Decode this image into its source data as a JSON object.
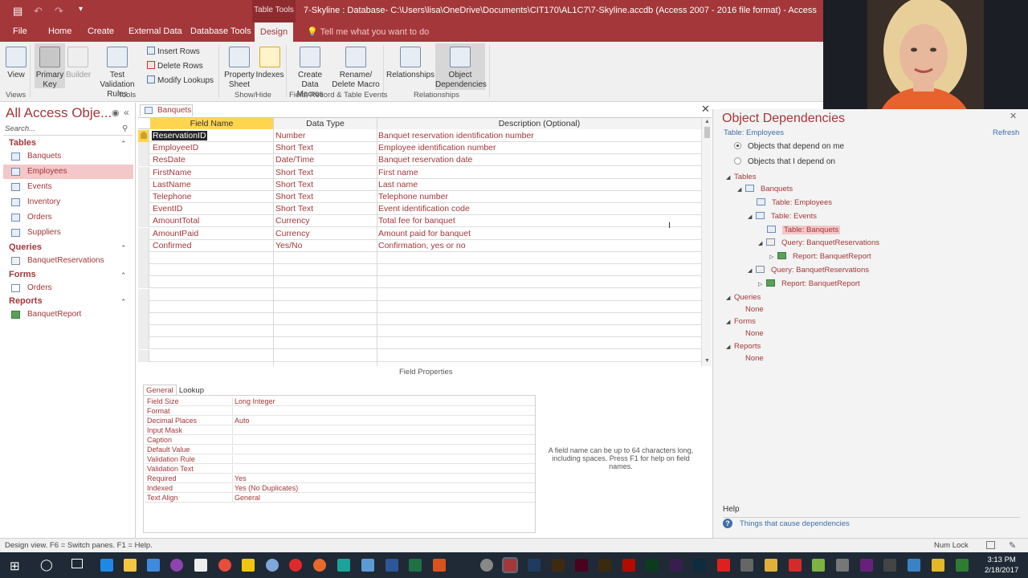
{
  "window": {
    "title": "7-Skyline : Database- C:\\Users\\lisa\\OneDrive\\Documents\\CIT170\\AL1C7\\7-Skyline.accdb (Access 2007 - 2016 file format) - Access",
    "context_tab": "Table Tools"
  },
  "ribbon_tabs": [
    "File",
    "Home",
    "Create",
    "External Data",
    "Database Tools",
    "Design"
  ],
  "tell_me": "Tell me what you want to do",
  "ribbon": {
    "view": "View",
    "primary_key": [
      "Primary",
      "Key"
    ],
    "builder": "Builder",
    "test_validation": [
      "Test Validation",
      "Rules"
    ],
    "insert_rows": "Insert Rows",
    "delete_rows": "Delete Rows",
    "modify_lookups": "Modify Lookups",
    "property_sheet": [
      "Property",
      "Sheet"
    ],
    "indexes": "Indexes",
    "create_data_macros": [
      "Create Data",
      "Macros"
    ],
    "rename_delete_macro": [
      "Rename/",
      "Delete Macro"
    ],
    "relationships": "Relationships",
    "object_dependencies": [
      "Object",
      "Dependencies"
    ],
    "groups": {
      "views": "Views",
      "tools": "Tools",
      "show_hide": "Show/Hide",
      "field_events": "Field, Record & Table Events",
      "relationships": "Relationships"
    }
  },
  "nav": {
    "title": "All Access Obje...",
    "search_placeholder": "Search...",
    "sections": {
      "tables": "Tables",
      "queries": "Queries",
      "forms": "Forms",
      "reports": "Reports"
    },
    "tables": [
      "Banquets",
      "Employees",
      "Events",
      "Inventory",
      "Orders",
      "Suppliers"
    ],
    "queries": [
      "BanquetReservations"
    ],
    "forms": [
      "Orders"
    ],
    "reports": [
      "BanquetReport"
    ]
  },
  "doc_tab": "Banquets",
  "grid": {
    "headers": [
      "Field Name",
      "Data Type",
      "Description (Optional)"
    ],
    "rows": [
      {
        "name": "ReservationID",
        "type": "Number",
        "desc": "Banquet reservation identification number"
      },
      {
        "name": "EmployeeID",
        "type": "Short Text",
        "desc": "Employee identification number"
      },
      {
        "name": "ResDate",
        "type": "Date/Time",
        "desc": "Banquet reservation date"
      },
      {
        "name": "FirstName",
        "type": "Short Text",
        "desc": "First name"
      },
      {
        "name": "LastName",
        "type": "Short Text",
        "desc": "Last name"
      },
      {
        "name": "Telephone",
        "type": "Short Text",
        "desc": "Telephone number"
      },
      {
        "name": "EventID",
        "type": "Short Text",
        "desc": "Event identification code"
      },
      {
        "name": "AmountTotal",
        "type": "Currency",
        "desc": "Total fee for banquet"
      },
      {
        "name": "AmountPaid",
        "type": "Currency",
        "desc": "Amount paid for banquet"
      },
      {
        "name": "Confirmed",
        "type": "Yes/No",
        "desc": "Confirmation, yes or no"
      }
    ]
  },
  "field_properties": {
    "label": "Field Properties",
    "tabs": [
      "General",
      "Lookup"
    ],
    "rows": [
      {
        "label": "Field Size",
        "value": "Long Integer"
      },
      {
        "label": "Format",
        "value": ""
      },
      {
        "label": "Decimal Places",
        "value": "Auto"
      },
      {
        "label": "Input Mask",
        "value": ""
      },
      {
        "label": "Caption",
        "value": ""
      },
      {
        "label": "Default Value",
        "value": ""
      },
      {
        "label": "Validation Rule",
        "value": ""
      },
      {
        "label": "Validation Text",
        "value": ""
      },
      {
        "label": "Required",
        "value": "Yes"
      },
      {
        "label": "Indexed",
        "value": "Yes (No Duplicates)"
      },
      {
        "label": "Text Align",
        "value": "General"
      }
    ],
    "hint": "A field name can be up to 64 characters long, including spaces. Press F1 for help on field names."
  },
  "dependencies": {
    "title": "Object Dependencies",
    "subject": "Table: Employees",
    "refresh": "Refresh",
    "option_depend_on_me": "Objects that depend on me",
    "option_i_depend_on": "Objects that I depend on",
    "tree": {
      "tables": "Tables",
      "banquets": "Banquets",
      "table_employees": "Table: Employees",
      "table_events": "Table: Events",
      "table_banquets": "Table: Banquets",
      "query_banquet_res_1": "Query: BanquetReservations",
      "report_1": "Report: BanquetReport",
      "query_banquet_res_2": "Query: BanquetReservations",
      "report_2": "Report: BanquetReport",
      "queries": "Queries",
      "queries_none": "None",
      "forms": "Forms",
      "forms_none": "None",
      "reports": "Reports",
      "reports_none": "None"
    },
    "help_label": "Help",
    "help_link": "Things that cause dependencies"
  },
  "status": {
    "left": "Design view.  F6 = Switch panes.  F1 = Help.",
    "num_lock": "Num Lock"
  },
  "clock": {
    "time": "3:13 PM",
    "date": "2/18/2017"
  }
}
